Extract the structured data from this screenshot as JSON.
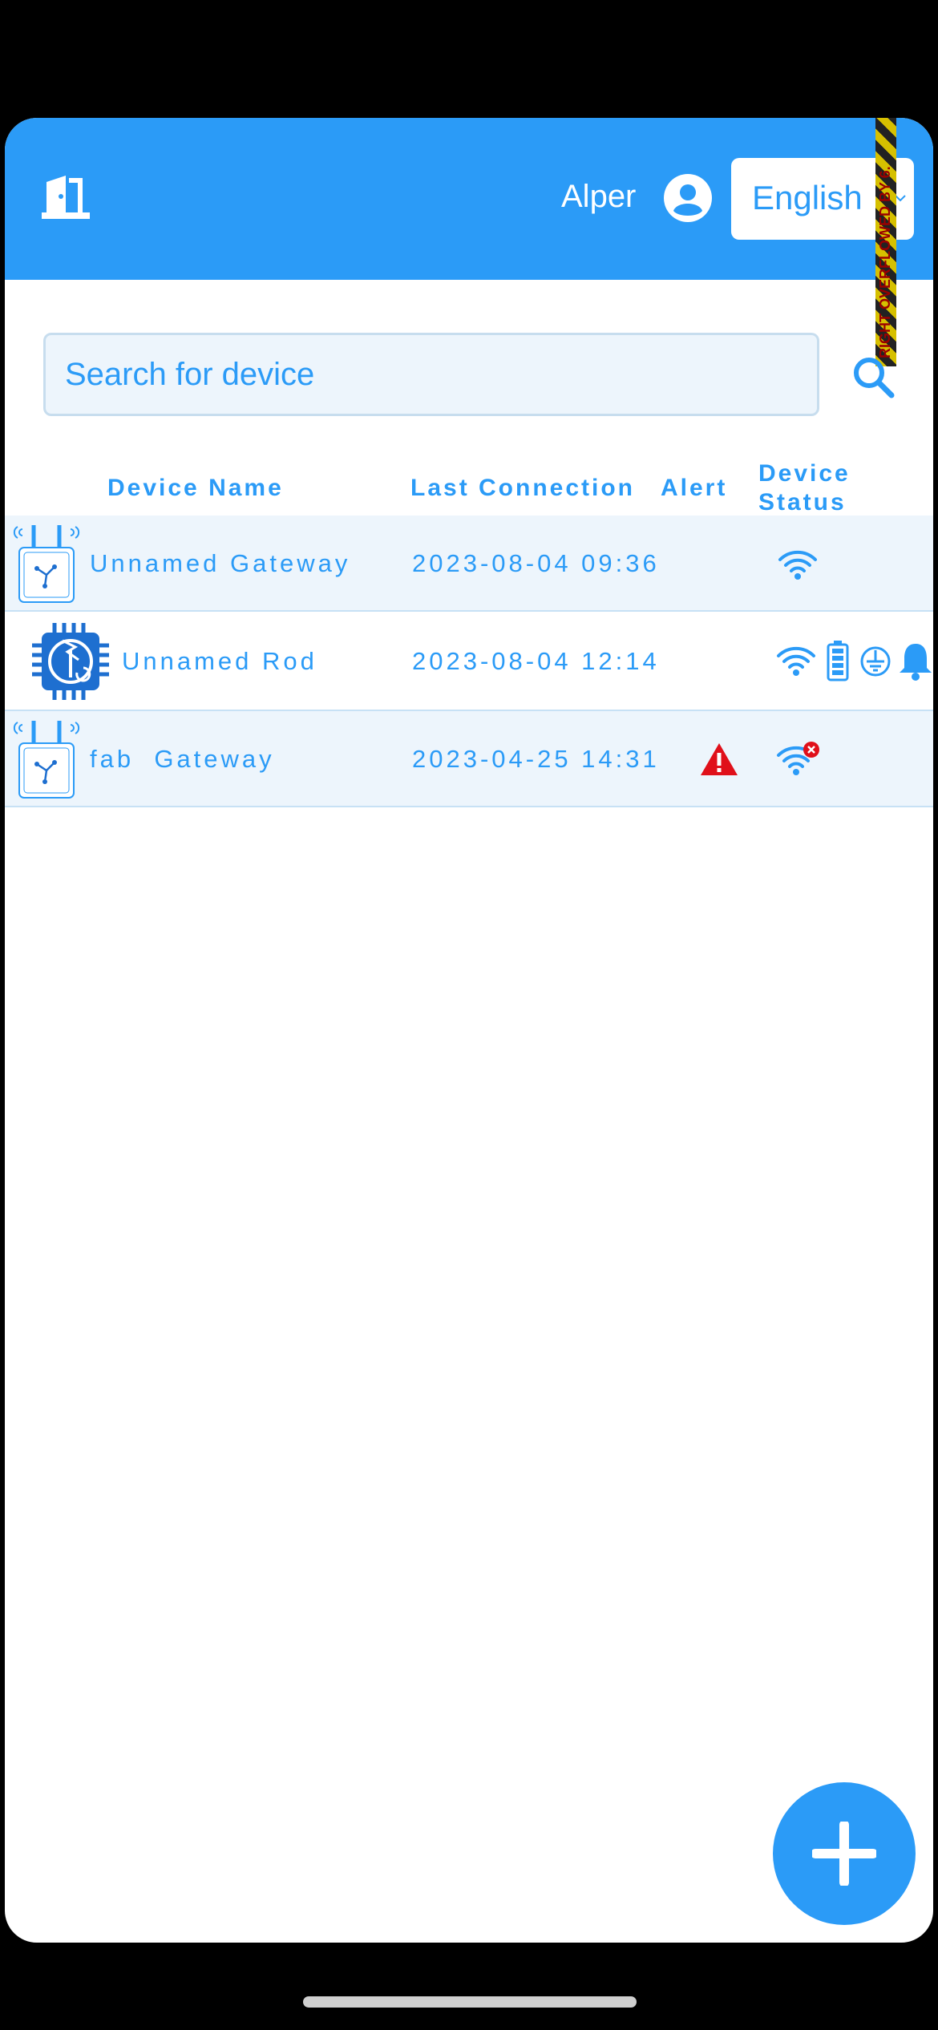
{
  "header": {
    "username": "Alper",
    "language": "English",
    "icons": {
      "logout": "door-exit-icon",
      "account": "account-circle-icon",
      "dropdown": "chevron-down-icon"
    }
  },
  "debug_banner": {
    "text": "RIGHT OVERFLOWED BY 6."
  },
  "search": {
    "placeholder": "Search for device",
    "value": "",
    "icon": "search-icon"
  },
  "table": {
    "columns": [
      "Device Name",
      "Last Connection",
      "Alert",
      "Device",
      "Status"
    ],
    "rows": [
      {
        "name": "Unnamed Gateway",
        "last_connection": "2023-08-04 09:36",
        "type_icon": "gateway-icon",
        "alert": false,
        "status_icons": [
          "wifi-icon"
        ]
      },
      {
        "name": "Unnamed Rod",
        "last_connection": "2023-08-04 12:14",
        "type_icon": "lightning-rod-chip-icon",
        "alert": false,
        "status_icons": [
          "wifi-icon",
          "battery-icon",
          "ground-icon",
          "bell-icon"
        ]
      },
      {
        "name": "fab  Gateway",
        "last_connection": "2023-04-25 14:31",
        "type_icon": "gateway-icon",
        "alert": true,
        "status_icons": [
          "wifi-off-icon"
        ]
      }
    ]
  },
  "fab": {
    "icon": "plus-icon"
  },
  "colors": {
    "primary": "#2b9bf7",
    "alert": "#e0101a",
    "row_alt": "#edf5fc"
  }
}
